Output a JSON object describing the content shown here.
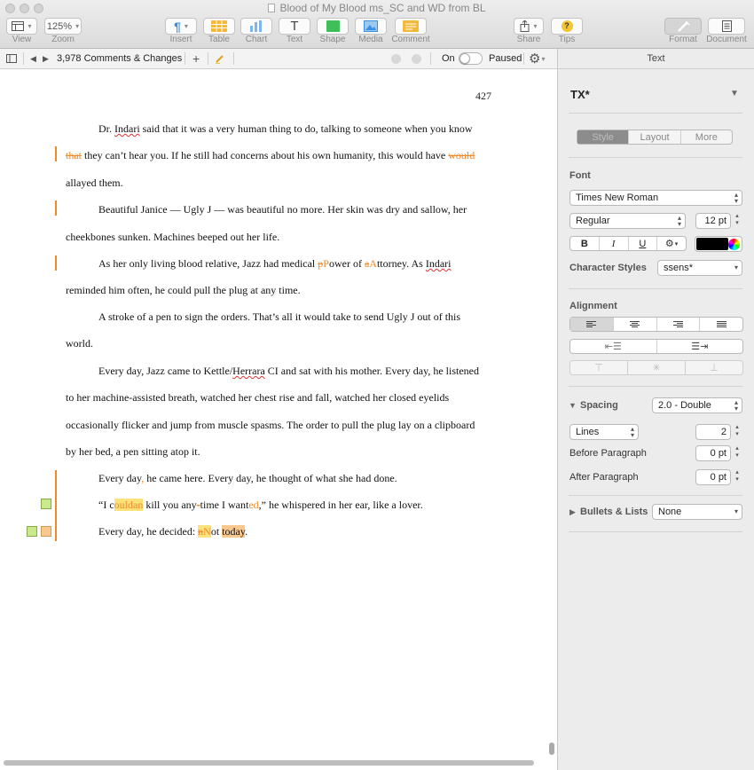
{
  "window": {
    "title": "Blood of My Blood ms_SC and WD from BL"
  },
  "toolbar": {
    "view_label": "View",
    "zoom_value": "125%",
    "zoom_label": "Zoom",
    "insert_label": "Insert",
    "table_label": "Table",
    "chart_label": "Chart",
    "text_label": "Text",
    "shape_label": "Shape",
    "media_label": "Media",
    "comment_label": "Comment",
    "share_label": "Share",
    "tips_label": "Tips",
    "format_label": "Format",
    "document_label": "Document"
  },
  "changebar": {
    "count_label": "3,978 Comments & Changes",
    "on_label": "On",
    "paused_label": "Paused"
  },
  "doc": {
    "page_number": "427",
    "p1": {
      "l1": "Dr. ",
      "l1_sq": "Indari",
      "l1_rest": " said that it was a very human thing to do, talking to someone when you know",
      "l2_del": "that",
      "l2_a": " they can’t hear you. If he still had concerns about his own humanity, this would have ",
      "l2_del2": "would",
      "l3": "allayed them."
    },
    "p2": {
      "l1": "Beautiful Janice — Ugly J — was beautiful no more. Her skin was dry and sallow, her",
      "l2": "cheekbones sunken. Machines beeped out her life."
    },
    "p3": {
      "l1_a": "As her only living blood relative, Jazz had medical ",
      "l1_del1": "p",
      "l1_ins1": "P",
      "l1_b": "ower of ",
      "l1_del2": "a",
      "l1_ins2": "A",
      "l1_c": "ttorney. As ",
      "l1_sq": "Indari",
      "l2": "reminded him often, he could pull the plug at any time."
    },
    "p4": {
      "l1": "A stroke of a pen to sign the orders. That’s all it would take to send Ugly J out of this",
      "l2": "world."
    },
    "p5": {
      "l1_a": "Every day, Jazz came to Kettle/",
      "l1_sq": "Herrara",
      "l1_b": " CI and sat with his mother. Every day, he listened",
      "l2": "to her machine-assisted breath, watched her chest rise and fall, watched her closed eyelids",
      "l3": "occasionally flicker and jump from muscle spasms. The order to pull the plug lay on a clipboard",
      "l4": "by her bed, a pen sitting atop it."
    },
    "p6": {
      "l1_a": "Every day",
      "l1_ins": ",",
      "l1_b": " he came here. Every day, he thought of what she had done."
    },
    "p7": {
      "l1_a": "“I c",
      "l1_hl": "ouldan",
      "l1_b": " kill you any",
      "l1_del": "-",
      "l1_c": "time I want",
      "l1_ins": "ed",
      "l1_d": ",” he whispered in her ear, like a lover."
    },
    "p8": {
      "l1_a": "Every day, he decided: ",
      "l1_del": "n",
      "l1_ins": "N",
      "l1_b": "ot ",
      "l1_hl": "today",
      "l1_c": "."
    }
  },
  "inspector": {
    "title": "Text",
    "paragraph_style": "TX*",
    "tabs": [
      "Style",
      "Layout",
      "More"
    ],
    "font_heading": "Font",
    "font_family": "Times New Roman",
    "font_typeface": "Regular",
    "font_size": "12 pt",
    "bold": "B",
    "italic": "I",
    "underline": "U",
    "text_color": "#000000",
    "char_styles_label": "Character Styles",
    "char_styles_value": "ssens*",
    "alignment_heading": "Alignment",
    "spacing_label": "Spacing",
    "spacing_value": "2.0 - Double",
    "lines_label": "Lines",
    "lines_value": "2",
    "before_para_label": "Before Paragraph",
    "before_para_value": "0 pt",
    "after_para_label": "After Paragraph",
    "after_para_value": "0 pt",
    "bullets_label": "Bullets & Lists",
    "bullets_value": "None"
  },
  "colors": {
    "accent": "#f0892a",
    "comment_green": "#c9ea8a",
    "comment_orange": "#f8c88e",
    "highlight": "#fbe27a"
  }
}
